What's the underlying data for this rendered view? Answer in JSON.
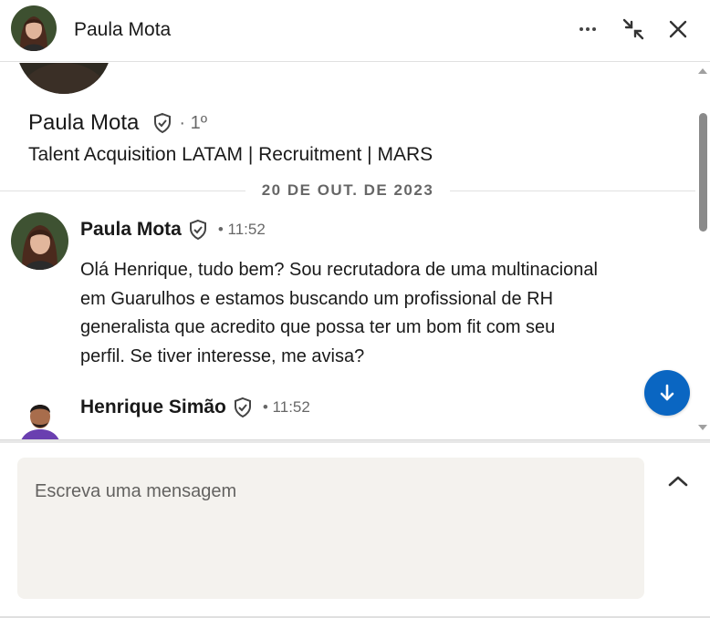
{
  "header": {
    "name": "Paula Mota",
    "more_icon": "more-horizontal-icon",
    "minimize_icon": "minimize-arrows-icon",
    "close_icon": "close-icon"
  },
  "profile": {
    "name": "Paula Mota",
    "degree": "· 1º",
    "headline": "Talent Acquisition LATAM | Recruitment | MARS",
    "verified_icon": "verified-shield-icon"
  },
  "thread": {
    "date_divider": "20 DE OUT. DE 2023",
    "messages": [
      {
        "sender": "Paula Mota",
        "time": "• 11:52",
        "body": "Olá Henrique, tudo bem? Sou recrutadora de uma multinacional em Guarulhos e estamos buscando um profissional de RH generalista que acredito que possa ter um bom fit com seu perfil. Se tiver interesse, me avisa?"
      },
      {
        "sender": "Henrique Simão",
        "time": "• 11:52",
        "body": ""
      }
    ]
  },
  "composer": {
    "placeholder": "Escreva uma mensagem"
  },
  "colors": {
    "accent": "#0a66c2",
    "composer_bg": "#f4f2ee",
    "divider": "#e0e0e0"
  }
}
